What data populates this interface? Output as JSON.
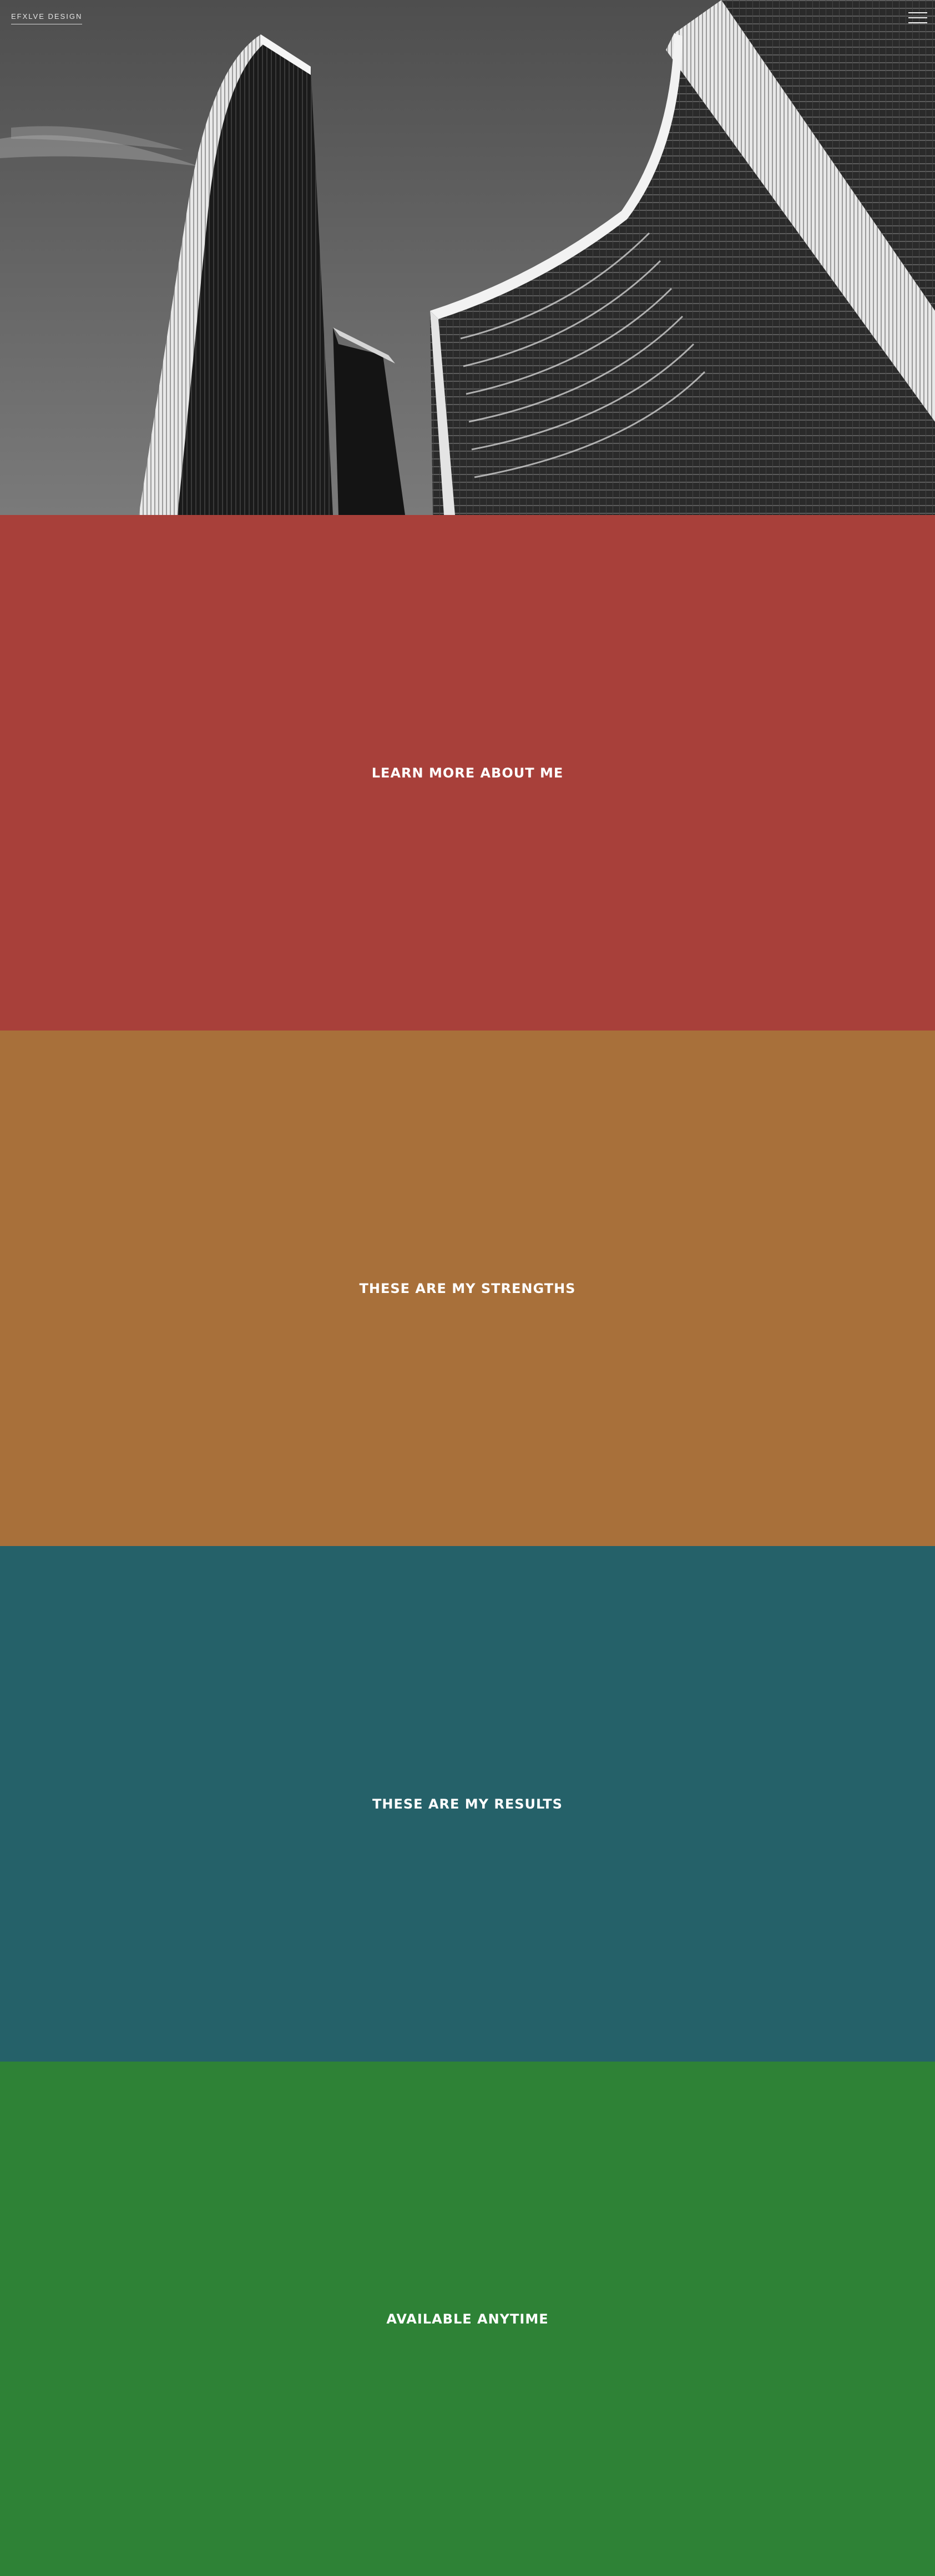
{
  "header": {
    "brand": "EFXLVE DESIGN",
    "menu_icon": "hamburger-menu-icon"
  },
  "hero": {
    "image": "black-and-white-skyscrapers-photo"
  },
  "sections": [
    {
      "label": "LEARN MORE ABOUT ME",
      "color": "#a8403a"
    },
    {
      "label": "THESE ARE MY STRENGTHS",
      "color": "#a8703a"
    },
    {
      "label": "THESE ARE MY RESULTS",
      "color": "#256169"
    },
    {
      "label": "AVAILABLE ANYTIME",
      "color": "#2e8236"
    }
  ]
}
